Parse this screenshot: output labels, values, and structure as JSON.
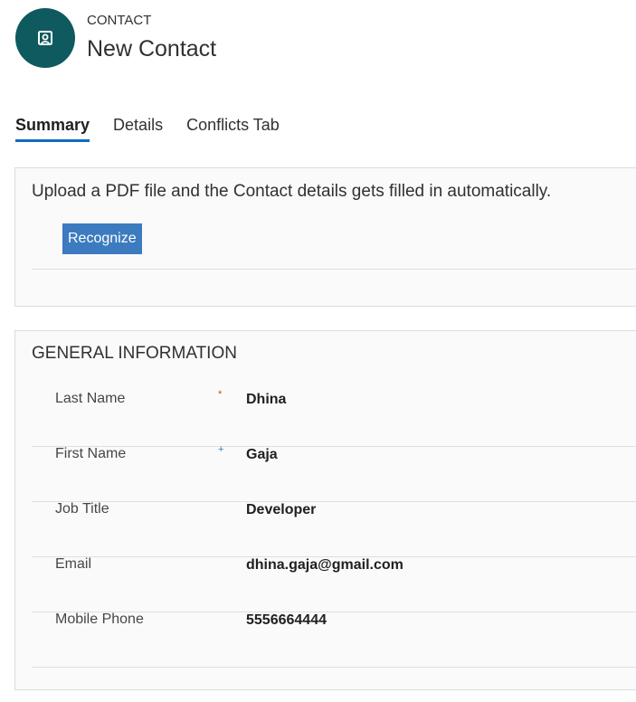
{
  "header": {
    "entity_type": "CONTACT",
    "record_title": "New Contact"
  },
  "tabs": [
    {
      "label": "Summary",
      "active": true
    },
    {
      "label": "Details",
      "active": false
    },
    {
      "label": "Conflicts Tab",
      "active": false
    }
  ],
  "upload_section": {
    "description": "Upload a PDF file and the Contact details gets filled in automatically.",
    "button_label": "Recognize"
  },
  "general_section": {
    "title": "GENERAL INFORMATION",
    "fields": [
      {
        "label": "Last Name",
        "marker": "*",
        "marker_type": "required",
        "value": "Dhina"
      },
      {
        "label": "First Name",
        "marker": "+",
        "marker_type": "recommended",
        "value": "Gaja"
      },
      {
        "label": "Job Title",
        "marker": "",
        "marker_type": "none",
        "value": "Developer"
      },
      {
        "label": "Email",
        "marker": "",
        "marker_type": "none",
        "value": "dhina.gaja@gmail.com"
      },
      {
        "label": "Mobile Phone",
        "marker": "",
        "marker_type": "none",
        "value": "5556664444"
      }
    ]
  },
  "colors": {
    "avatar_bg": "#0f5a5e",
    "tab_underline": "#0f6cbd",
    "button_bg": "#3c7bbf",
    "required_marker": "#d24726",
    "recommended_marker": "#2f78c4"
  },
  "icons": {
    "avatar": "contact-card-icon"
  }
}
